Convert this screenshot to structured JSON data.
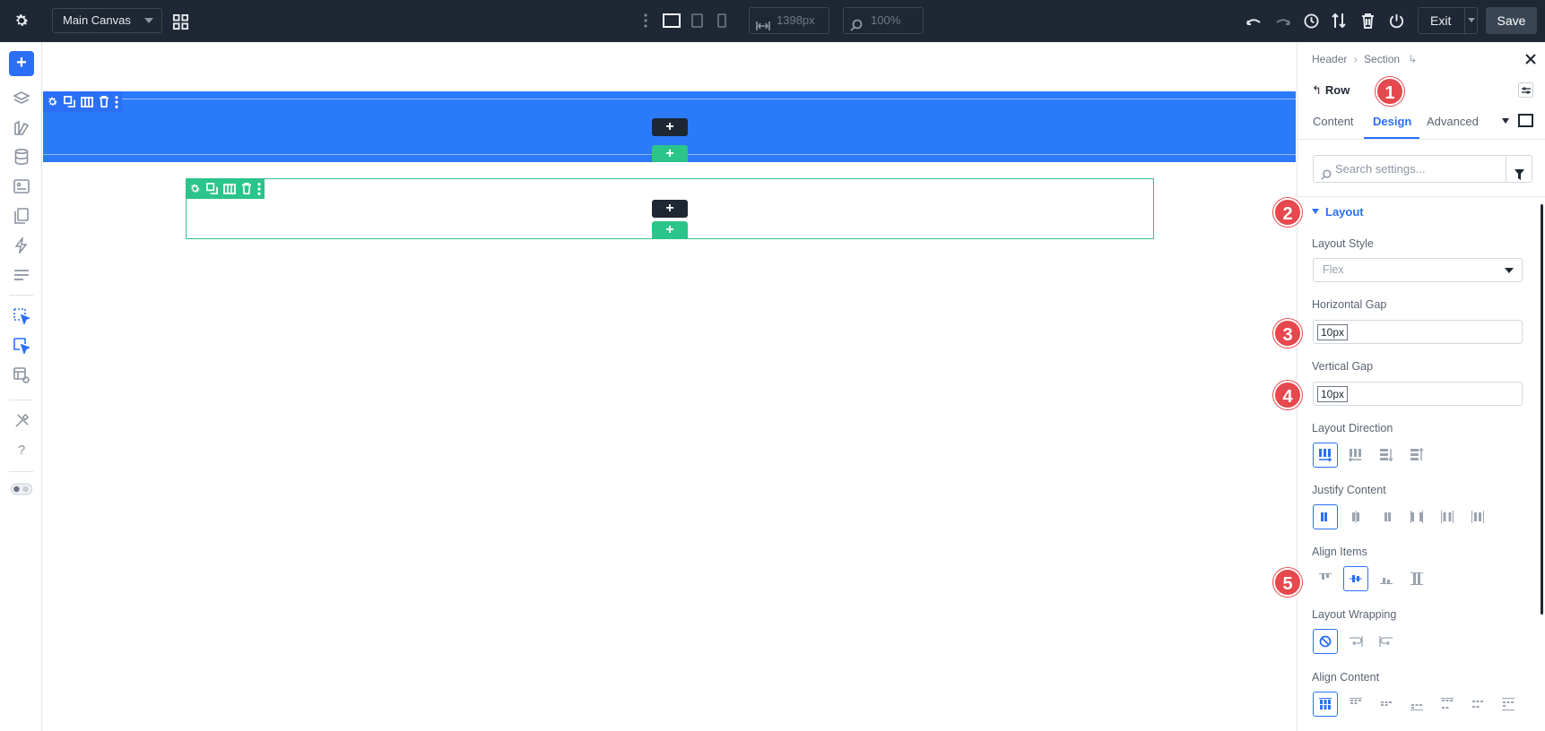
{
  "topbar": {
    "canvas_select": "Main Canvas",
    "width_value": "1398px",
    "zoom_value": "100%",
    "exit_label": "Exit",
    "save_label": "Save"
  },
  "canvas": {
    "section_add": "+",
    "section_add_row": "+",
    "row_add": "+",
    "row_add_module": "+"
  },
  "panel": {
    "breadcrumb": [
      "Header",
      "Section"
    ],
    "module_title": "Row",
    "tabs": [
      "Content",
      "Design",
      "Advanced"
    ],
    "active_tab": "Design",
    "search_placeholder": "Search settings...",
    "group_title": "Layout",
    "fields": {
      "layout_style_label": "Layout Style",
      "layout_style_value": "Flex",
      "hgap_label": "Horizontal Gap",
      "hgap_value": "10px",
      "vgap_label": "Vertical Gap",
      "vgap_value": "10px",
      "direction_label": "Layout Direction",
      "justify_label": "Justify Content",
      "align_items_label": "Align Items",
      "wrapping_label": "Layout Wrapping",
      "align_content_label": "Align Content"
    }
  },
  "badges": [
    "1",
    "2",
    "3",
    "4",
    "5"
  ],
  "colors": {
    "topbar": "#1e2733",
    "accent": "#2b6ff7",
    "section": "#2b7af9",
    "row": "#2bc48a",
    "badge": "#e5484d"
  }
}
